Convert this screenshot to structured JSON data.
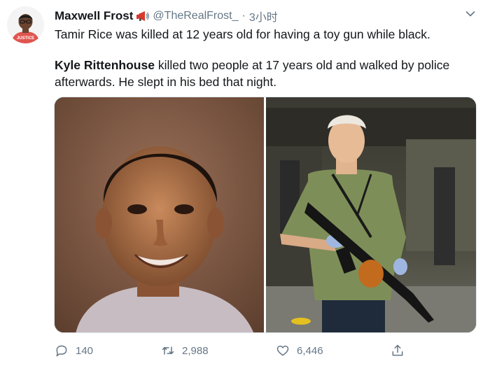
{
  "tweet": {
    "author": {
      "display_name": "Maxwell Frost",
      "handle": "@TheRealFrost_",
      "avatar_text": "JUSTICE",
      "badge_icon": "megaphone-icon"
    },
    "separator": "·",
    "timestamp": "3小时",
    "text": {
      "line1": "Tamir Rice was killed at 12 years old for having a toy gun while black.",
      "para2_name": "Kyle Rittenhouse",
      "para2_rest": " killed two people at 17 years old and walked by police afterwards. He slept in his bed that night."
    },
    "media": {
      "left_photo": "portrait-photo",
      "right_photo": "street-photo"
    },
    "actions": {
      "reply_count": "140",
      "retweet_count": "2,988",
      "like_count": "6,446"
    }
  },
  "colors": {
    "text_primary": "#14171a",
    "text_secondary": "#657786",
    "icon": "#657786",
    "avatar_shirt": "#e0544f",
    "megaphone_red": "#d63b2f"
  }
}
